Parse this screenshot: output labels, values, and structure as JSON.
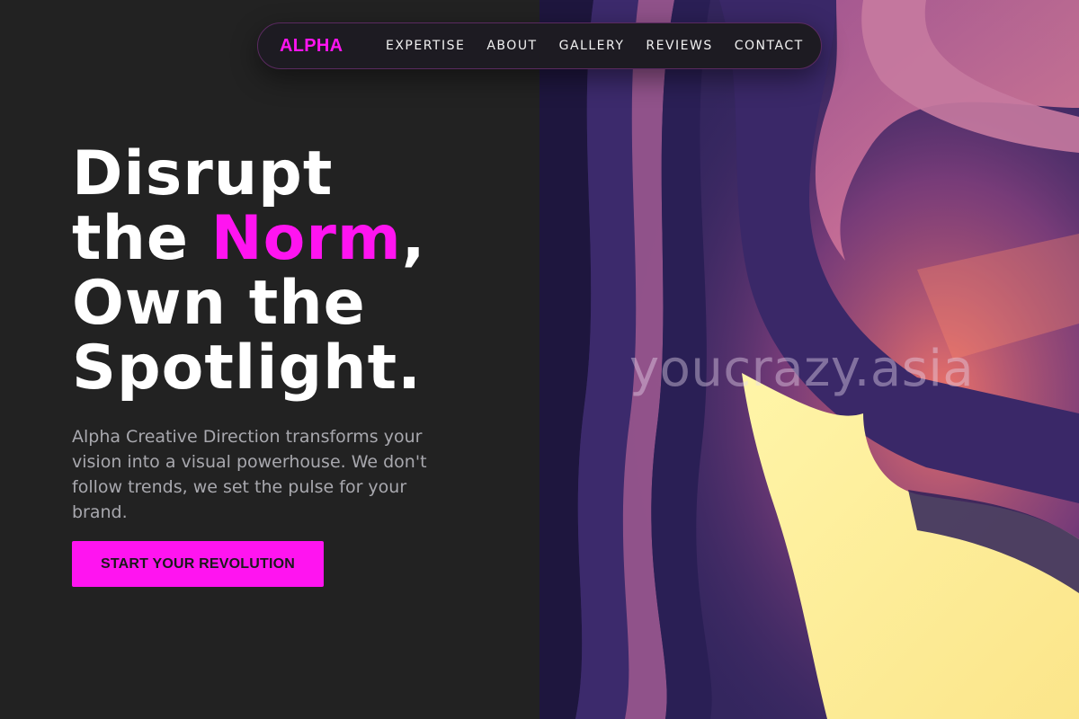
{
  "nav": {
    "brand": "ALPHA",
    "links": [
      {
        "label": "EXPERTISE"
      },
      {
        "label": "ABOUT"
      },
      {
        "label": "GALLERY"
      },
      {
        "label": "REVIEWS"
      },
      {
        "label": "CONTACT"
      }
    ]
  },
  "hero": {
    "title_line1": "Disrupt",
    "title_line2_start": "the ",
    "title_accent": "Norm",
    "title_line2_end": ",",
    "title_line3": "Own the",
    "title_line4": "Spotlight.",
    "description": "Alpha Creative Direction transforms your vision into a visual powerhouse. We don't follow trends, we set the pulse for your brand.",
    "cta_label": "START YOUR REVOLUTION"
  },
  "image": {
    "watermark": "youcrazy.asia"
  },
  "colors": {
    "background": "#222222",
    "accent": "#ff14f0",
    "text_primary": "#ffffff",
    "text_muted": "#a8a8ae"
  }
}
